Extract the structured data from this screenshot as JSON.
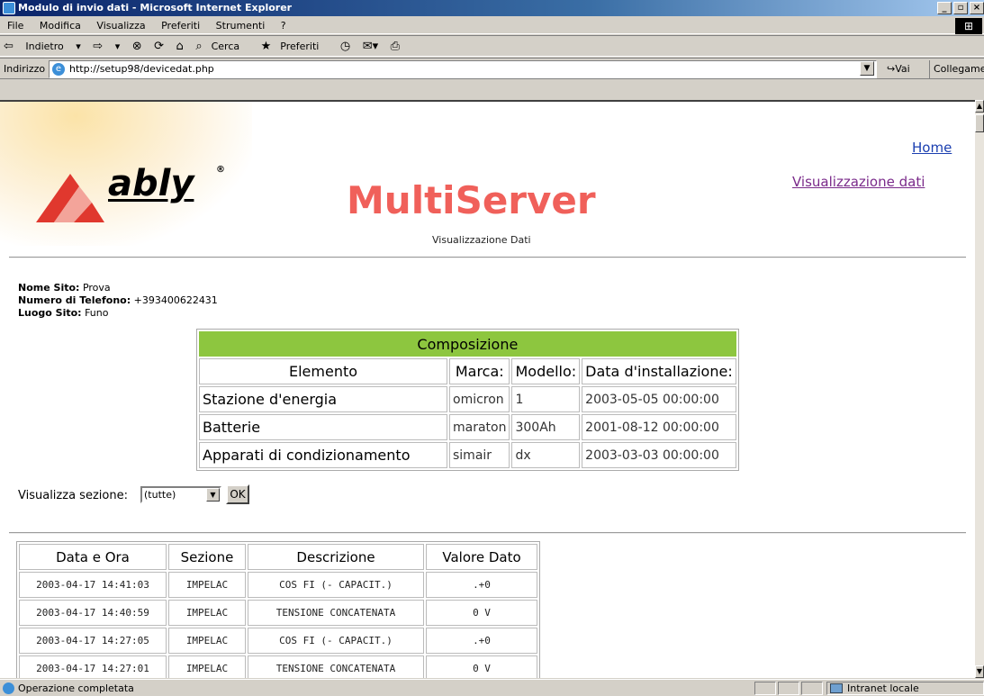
{
  "window": {
    "title": "Modulo di invio dati - Microsoft Internet Explorer",
    "min_label": "_",
    "max_label": "▫",
    "close_label": "×"
  },
  "menu": [
    "File",
    "Modifica",
    "Visualizza",
    "Preferiti",
    "Strumenti",
    "?"
  ],
  "toolbar": {
    "back": "Indietro",
    "search": "Cerca",
    "favorites": "Preferiti"
  },
  "address": {
    "label": "Indirizzo",
    "url": "http://setup98/devicedat.php",
    "go": "Vai",
    "links": "Collegamenti"
  },
  "page": {
    "logo_text": "ably",
    "logo_reg": "®",
    "title": "MultiServer",
    "subtitle": "Visualizzazione Dati",
    "nav": {
      "home": "Home",
      "data_view": "Visualizzazione dati"
    },
    "site": {
      "name_label": "Nome Sito:",
      "name": "Prova",
      "phone_label": "Numero di Telefono:",
      "phone": "+393400622431",
      "place_label": "Luogo Sito:",
      "place": "Funo"
    },
    "composition": {
      "title": "Composizione",
      "headers": [
        "Elemento",
        "Marca:",
        "Modello:",
        "Data d'installazione:"
      ],
      "rows": [
        [
          "Stazione d'energia",
          "omicron",
          "1",
          "2003-05-05 00:00:00"
        ],
        [
          "Batterie",
          "maraton",
          "300Ah",
          "2001-08-12 00:00:00"
        ],
        [
          "Apparati di condizionamento",
          "simair",
          "dx",
          "2003-03-03 00:00:00"
        ]
      ]
    },
    "section": {
      "label": "Visualizza sezione:",
      "selected": "(tutte)",
      "ok": "OK"
    },
    "data_table": {
      "headers": [
        "Data e Ora",
        "Sezione",
        "Descrizione",
        "Valore Dato"
      ],
      "rows": [
        [
          "2003-04-17 14:41:03",
          "IMPELAC",
          "COS FI (- CAPACIT.)",
          ".+0"
        ],
        [
          "2003-04-17 14:40:59",
          "IMPELAC",
          "TENSIONE CONCATENATA",
          "0 V"
        ],
        [
          "2003-04-17 14:27:05",
          "IMPELAC",
          "COS FI (- CAPACIT.)",
          ".+0"
        ],
        [
          "2003-04-17 14:27:01",
          "IMPELAC",
          "TENSIONE CONCATENATA",
          "0 V"
        ]
      ]
    }
  },
  "status": {
    "text": "Operazione completata",
    "zone": "Intranet locale"
  }
}
